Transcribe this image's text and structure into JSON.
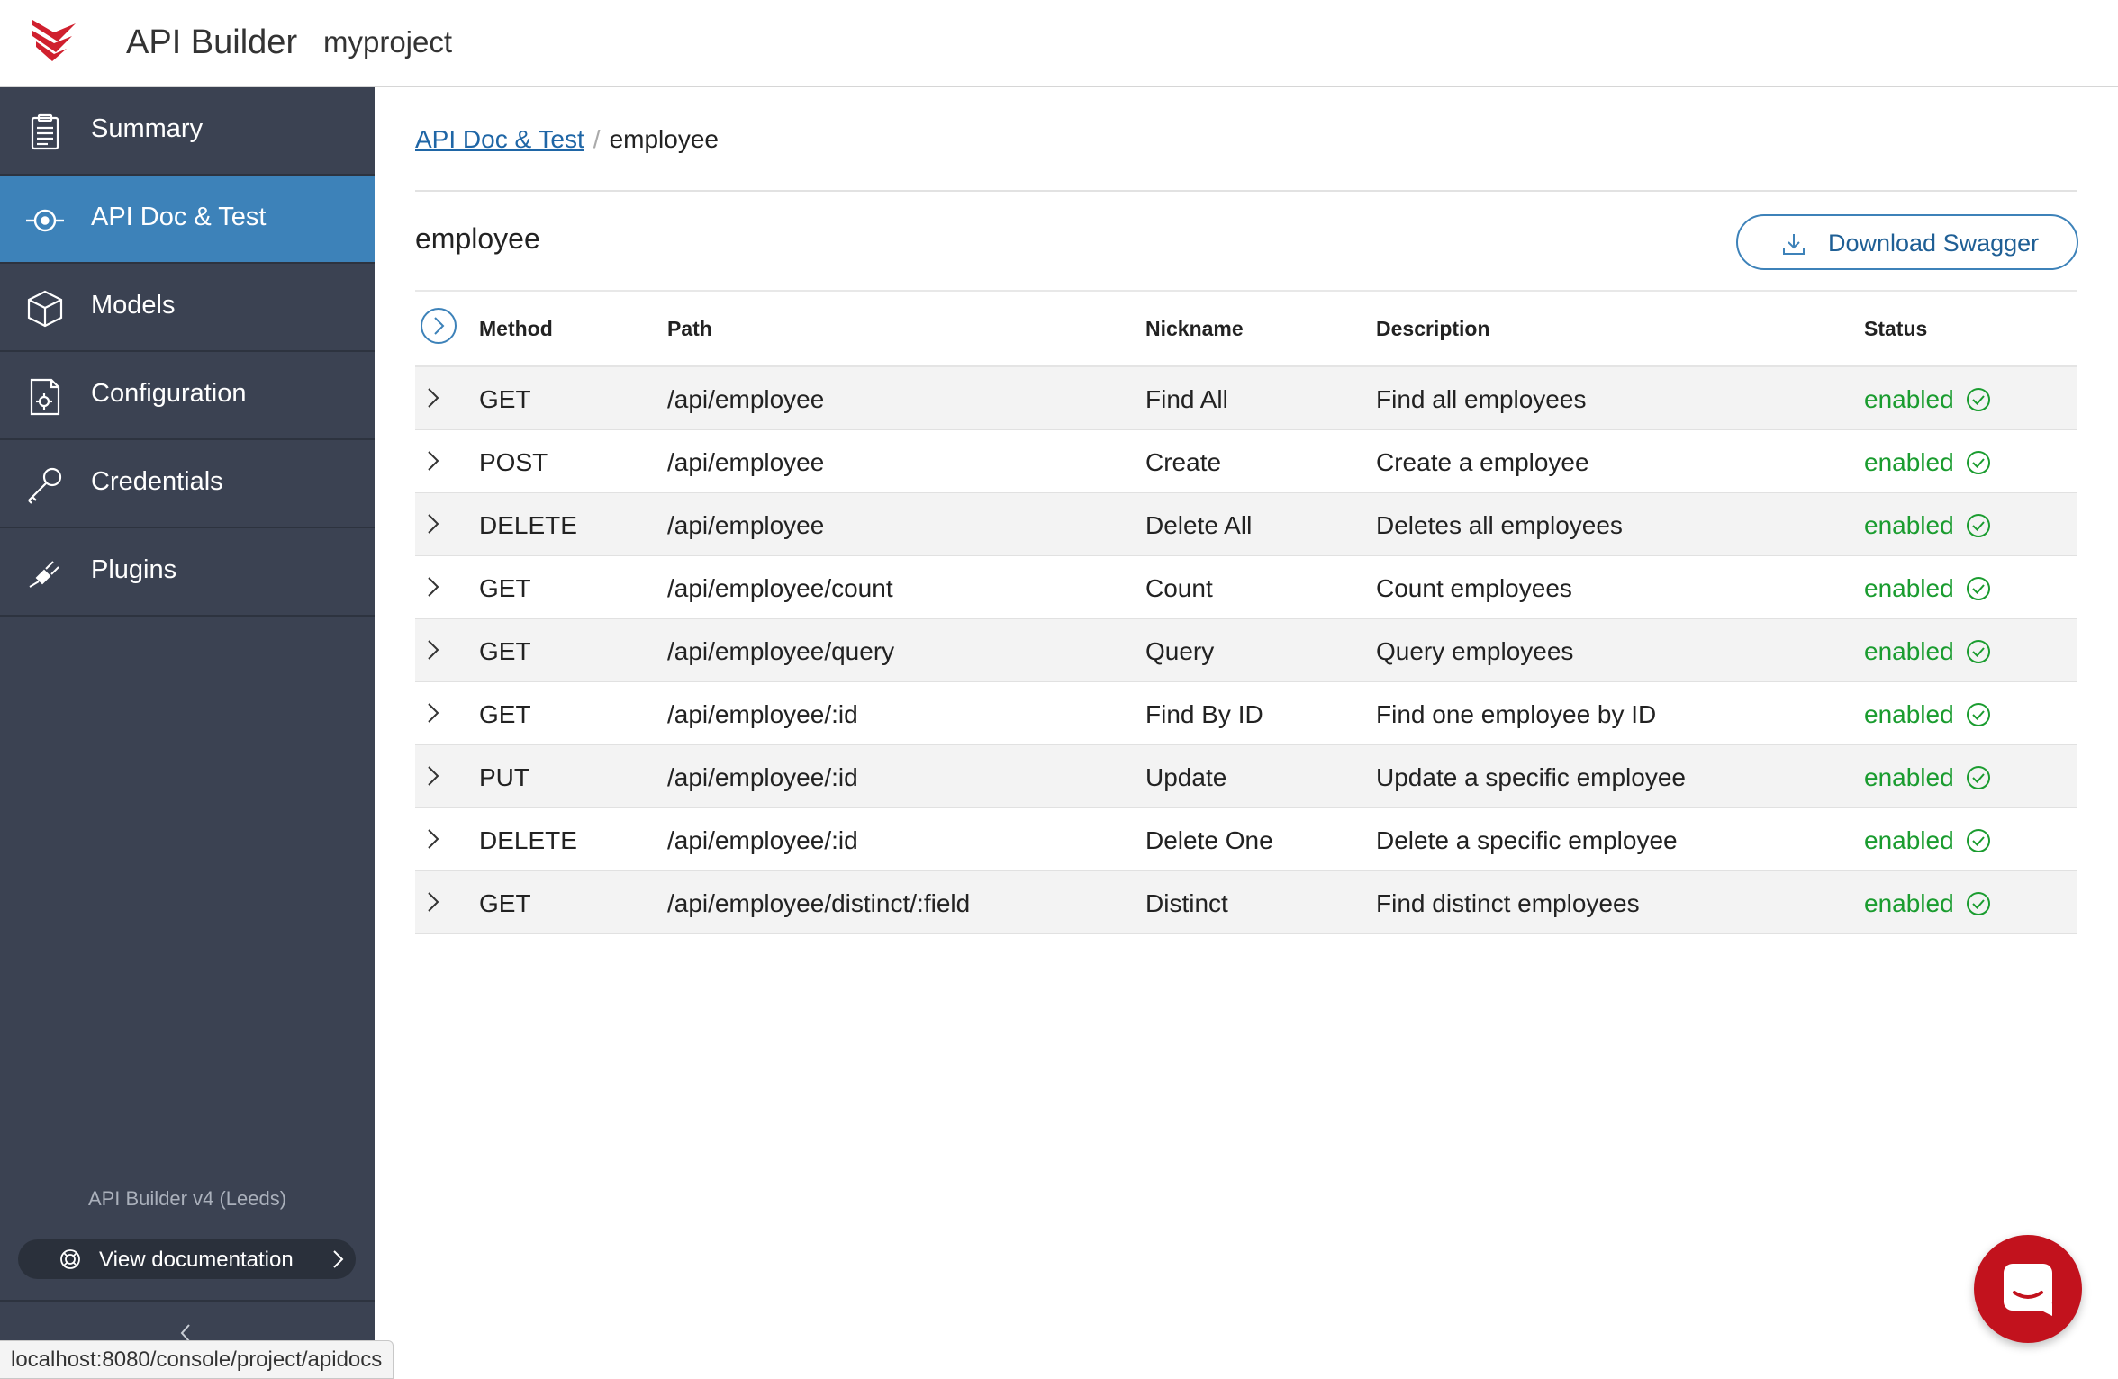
{
  "header": {
    "app_title": "API Builder",
    "project_name": "myproject",
    "brand_color": "#d0202e"
  },
  "sidebar": {
    "items": [
      {
        "label": "Summary",
        "icon": "clipboard-icon",
        "active": false
      },
      {
        "label": "API Doc & Test",
        "icon": "target-icon",
        "active": true
      },
      {
        "label": "Models",
        "icon": "cube-icon",
        "active": false
      },
      {
        "label": "Configuration",
        "icon": "config-file-icon",
        "active": false
      },
      {
        "label": "Credentials",
        "icon": "key-icon",
        "active": false
      },
      {
        "label": "Plugins",
        "icon": "plug-icon",
        "active": false
      }
    ],
    "version": "API Builder v4 (Leeds)",
    "view_doc_label": "View documentation",
    "active_color": "#3d82b9",
    "background_color": "#3b4252"
  },
  "status_bar": {
    "url": "localhost:8080/console/project/apidocs"
  },
  "main": {
    "breadcrumb": {
      "parent": "API Doc & Test",
      "separator": "/",
      "current": "employee"
    },
    "title": "employee",
    "download_label": "Download Swagger",
    "columns": [
      "Method",
      "Path",
      "Nickname",
      "Description",
      "Status"
    ],
    "rows": [
      {
        "method": "GET",
        "path": "/api/employee",
        "nickname": "Find All",
        "description": "Find all employees",
        "status": "enabled"
      },
      {
        "method": "POST",
        "path": "/api/employee",
        "nickname": "Create",
        "description": "Create a employee",
        "status": "enabled"
      },
      {
        "method": "DELETE",
        "path": "/api/employee",
        "nickname": "Delete All",
        "description": "Deletes all employees",
        "status": "enabled"
      },
      {
        "method": "GET",
        "path": "/api/employee/count",
        "nickname": "Count",
        "description": "Count employees",
        "status": "enabled"
      },
      {
        "method": "GET",
        "path": "/api/employee/query",
        "nickname": "Query",
        "description": "Query employees",
        "status": "enabled"
      },
      {
        "method": "GET",
        "path": "/api/employee/:id",
        "nickname": "Find By ID",
        "description": "Find one employee by ID",
        "status": "enabled"
      },
      {
        "method": "PUT",
        "path": "/api/employee/:id",
        "nickname": "Update",
        "description": "Update a specific employee",
        "status": "enabled"
      },
      {
        "method": "DELETE",
        "path": "/api/employee/:id",
        "nickname": "Delete One",
        "description": "Delete a specific employee",
        "status": "enabled"
      },
      {
        "method": "GET",
        "path": "/api/employee/distinct/:field",
        "nickname": "Distinct",
        "description": "Find distinct employees",
        "status": "enabled"
      }
    ],
    "status_color": "#1a9c2f"
  },
  "chat": {
    "icon": "chat-icon",
    "color": "#c2121d"
  }
}
